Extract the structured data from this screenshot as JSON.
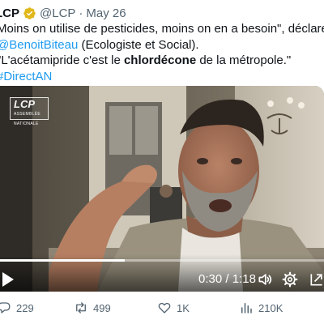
{
  "tweet": {
    "author_name": "LCP",
    "handle": "@LCP",
    "separator": "·",
    "date": "May 26",
    "text": {
      "line1": "Moins on utilise de pesticides, moins on en a besoin\", déclare",
      "mention": "@BenoitBiteau",
      "line2_rest": " (Ecologiste et Social).",
      "line3_start": "\"L'acétamipride c'est le ",
      "line3_bold": "chlordécone",
      "line3_end": " de la métropole.\"",
      "hashtag": "#DirectAN"
    }
  },
  "video": {
    "watermark": "LCP",
    "watermark_sub": "ASSEMBLÉE NATIONALE",
    "current_time": "0:30",
    "time_separator": " / ",
    "duration": "1:18",
    "progress": 0.385,
    "icons": [
      "play-icon",
      "volume-icon",
      "settings-icon",
      "expand-icon"
    ]
  },
  "actions": {
    "replies": "229",
    "reposts": "499",
    "likes": "1K",
    "views": "210K"
  },
  "colors": {
    "link": "#1d9bf0",
    "verified_gold": "#e2b719",
    "secondary_text": "#536471"
  }
}
